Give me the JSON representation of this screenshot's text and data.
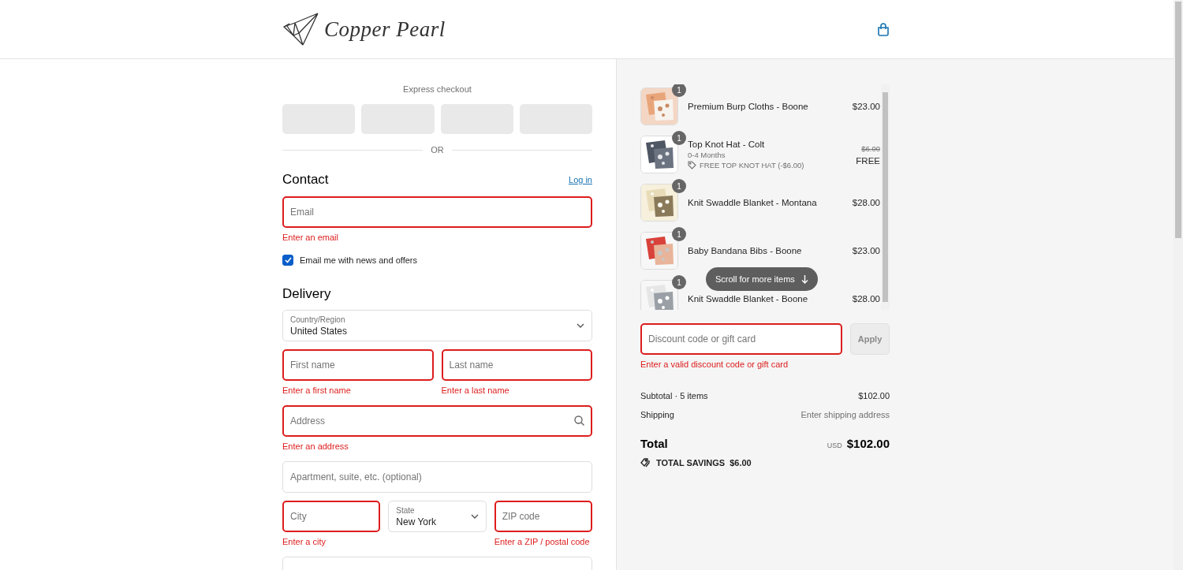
{
  "header": {
    "logo": "Copper Pearl"
  },
  "express_checkout": {
    "label": "Express checkout",
    "buttons": [
      {
        "kind": "wallet"
      },
      {
        "kind": "wallet"
      },
      {
        "kind": "wallet"
      },
      {
        "kind": "wallet"
      }
    ],
    "divider": "OR"
  },
  "contact": {
    "title": "Contact",
    "link": "Log in",
    "fields": [
      {
        "kind": "text",
        "placeholder": "Email",
        "invalid": true,
        "error": "Enter an email"
      }
    ],
    "newsletter": {
      "label": "Email me with news and offers",
      "checked": true
    }
  },
  "delivery": {
    "title": "Delivery",
    "rows": [
      [
        {
          "kind": "select",
          "label": "Country/Region",
          "value": "United States",
          "invalid": false
        }
      ],
      [
        {
          "kind": "text",
          "placeholder": "First name",
          "invalid": true,
          "error": "Enter a first name"
        },
        {
          "kind": "text",
          "placeholder": "Last name",
          "invalid": true,
          "error": "Enter a last name"
        }
      ],
      [
        {
          "kind": "search",
          "placeholder": "Address",
          "invalid": true,
          "error": "Enter an address"
        }
      ],
      [
        {
          "kind": "text",
          "placeholder": "Apartment, suite, etc. (optional)",
          "invalid": false
        }
      ],
      [
        {
          "kind": "text",
          "placeholder": "City",
          "invalid": true,
          "error": "Enter a city"
        },
        {
          "kind": "select",
          "label": "State",
          "value": "New York",
          "invalid": false
        },
        {
          "kind": "text",
          "placeholder": "ZIP code",
          "invalid": true,
          "error": "Enter a ZIP / postal code"
        }
      ],
      [
        {
          "kind": "text",
          "invalid": false
        }
      ]
    ]
  },
  "summary": {
    "items": [
      {
        "name": "Premium Burp Cloths - Boone",
        "quantity": "1",
        "price": "$23.00"
      },
      {
        "name": "Top Knot Hat - Colt",
        "quantity": "1",
        "variant": "0-4 Months",
        "discount": "FREE TOP KNOT HAT (-$6.00)",
        "original_price": "$6.00",
        "price": "FREE"
      },
      {
        "name": "Knit Swaddle Blanket - Montana",
        "quantity": "1",
        "price": "$28.00"
      },
      {
        "name": "Baby Bandana Bibs - Boone",
        "quantity": "1",
        "price": "$23.00"
      },
      {
        "name": "Knit Swaddle Blanket - Boone",
        "quantity": "1",
        "price": "$28.00"
      }
    ],
    "scroll_hint": "Scroll for more items",
    "discount": {
      "placeholder": "Discount code or gift card",
      "invalid": true,
      "error": "Enter a valid discount code or gift card",
      "button": "Apply",
      "button_disabled": true
    },
    "subtotal": {
      "label": "Subtotal · 5 items",
      "value": "$102.00"
    },
    "shipping": {
      "label": "Shipping",
      "value": "Enter shipping address"
    },
    "total": {
      "label": "Total",
      "currency": "USD",
      "value": "$102.00"
    },
    "savings": {
      "label": "TOTAL SAVINGS",
      "value": "$6.00"
    }
  }
}
